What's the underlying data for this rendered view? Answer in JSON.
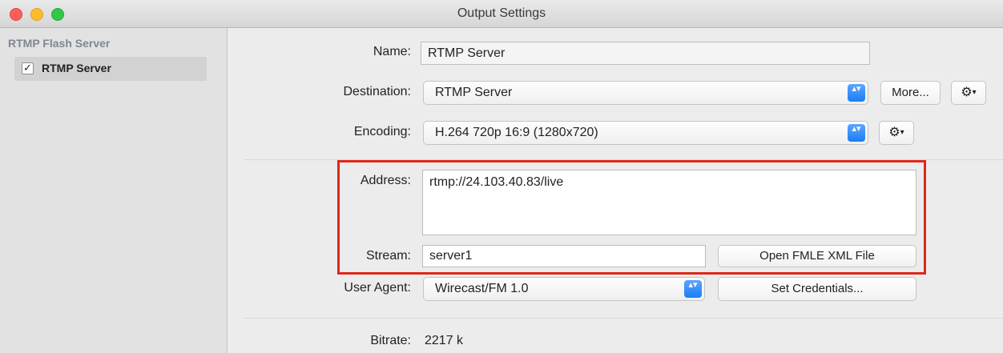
{
  "window": {
    "title": "Output Settings"
  },
  "sidebar": {
    "group_label": "RTMP Flash Server",
    "items": [
      {
        "label": "RTMP Server",
        "checked": true,
        "check_glyph": "✓"
      }
    ]
  },
  "form": {
    "name": {
      "label": "Name:",
      "value": "RTMP Server"
    },
    "destination": {
      "label": "Destination:",
      "value": "RTMP Server",
      "more_label": "More..."
    },
    "encoding": {
      "label": "Encoding:",
      "value": "H.264 720p 16:9 (1280x720)"
    },
    "address": {
      "label": "Address:",
      "value": "rtmp://24.103.40.83/live"
    },
    "stream": {
      "label": "Stream:",
      "value": "server1",
      "open_button": "Open FMLE XML File"
    },
    "user_agent": {
      "label": "User Agent:",
      "value": "Wirecast/FM 1.0",
      "credentials_button": "Set Credentials..."
    },
    "bitrate": {
      "label": "Bitrate:",
      "value": "2217 k"
    }
  },
  "icons": {
    "gear": "⚙",
    "caret": "▾",
    "popup_arrows": "▴▾"
  },
  "colors": {
    "highlight": "#e0271b",
    "accent": "#1a7ef5"
  }
}
